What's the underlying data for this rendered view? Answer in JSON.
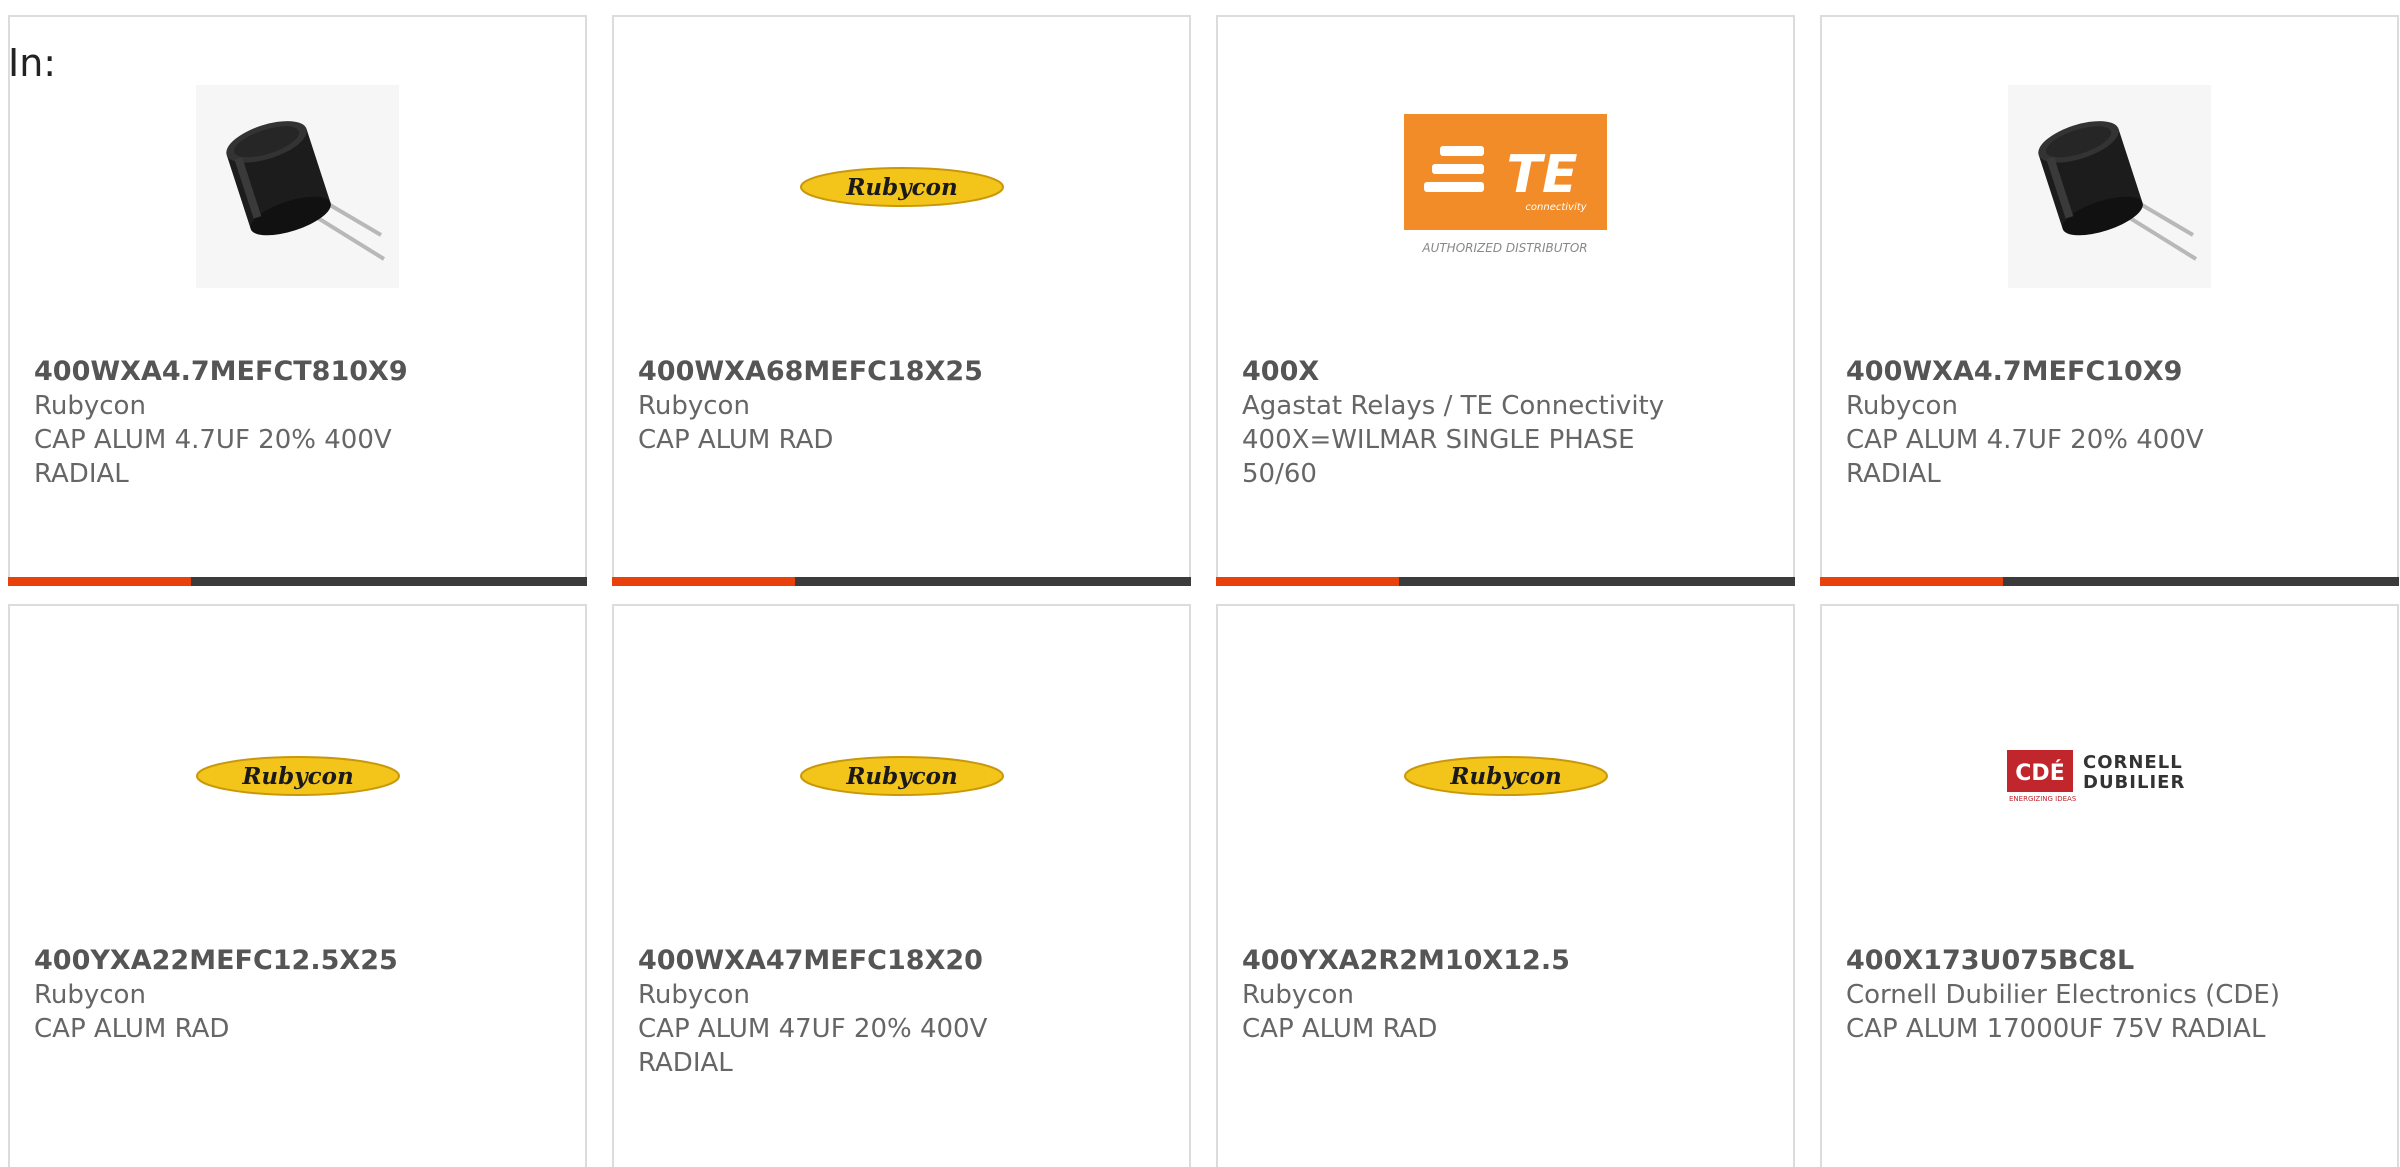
{
  "filter": {
    "label": "In:"
  },
  "products": [
    {
      "part_number": "400WXA4.7MEFCT810X9",
      "manufacturer": "Rubycon",
      "description": "CAP ALUM 4.7UF 20% 400V RADIAL",
      "image": "capacitor-photo",
      "accent_color": "#e8410c"
    },
    {
      "part_number": "400WXA68MEFC18X25",
      "manufacturer": "Rubycon",
      "description": "CAP ALUM RAD",
      "image": "rubycon-logo",
      "logo_text": "Rubycon"
    },
    {
      "part_number": "400X",
      "manufacturer": "Agastat Relays / TE Connectivity",
      "description": "400X=WILMAR SINGLE PHASE 50/60",
      "image": "te-connectivity-logo",
      "logo_text": "TE",
      "logo_subtext": "connectivity",
      "logo_caption": "AUTHORIZED DISTRIBUTOR"
    },
    {
      "part_number": "400WXA4.7MEFC10X9",
      "manufacturer": "Rubycon",
      "description": "CAP ALUM 4.7UF 20% 400V RADIAL",
      "image": "capacitor-photo"
    },
    {
      "part_number": "400YXA22MEFC12.5X25",
      "manufacturer": "Rubycon",
      "description": "CAP ALUM RAD",
      "image": "rubycon-logo",
      "logo_text": "Rubycon"
    },
    {
      "part_number": "400WXA47MEFC18X20",
      "manufacturer": "Rubycon",
      "description": "CAP ALUM 47UF 20% 400V RADIAL",
      "image": "rubycon-logo",
      "logo_text": "Rubycon"
    },
    {
      "part_number": "400YXA2R2M10X12.5",
      "manufacturer": "Rubycon",
      "description": "CAP ALUM RAD",
      "image": "rubycon-logo",
      "logo_text": "Rubycon"
    },
    {
      "part_number": "400X173U075BC8L",
      "manufacturer": "Cornell Dubilier Electronics (CDE)",
      "description": "CAP ALUM 17000UF 75V RADIAL",
      "image": "cde-logo",
      "logo_text": "CDÉ",
      "logo_name_1": "CORNELL",
      "logo_name_2": "DUBILIER",
      "logo_tagline": "ENERGIZING IDEAS"
    }
  ],
  "colors": {
    "accent": "#e8410c",
    "bar": "#3b3b3b",
    "border": "#dcdcdc",
    "rubycon_yellow": "#f3c419",
    "te_orange": "#f28c28",
    "cde_red": "#c0262c"
  }
}
